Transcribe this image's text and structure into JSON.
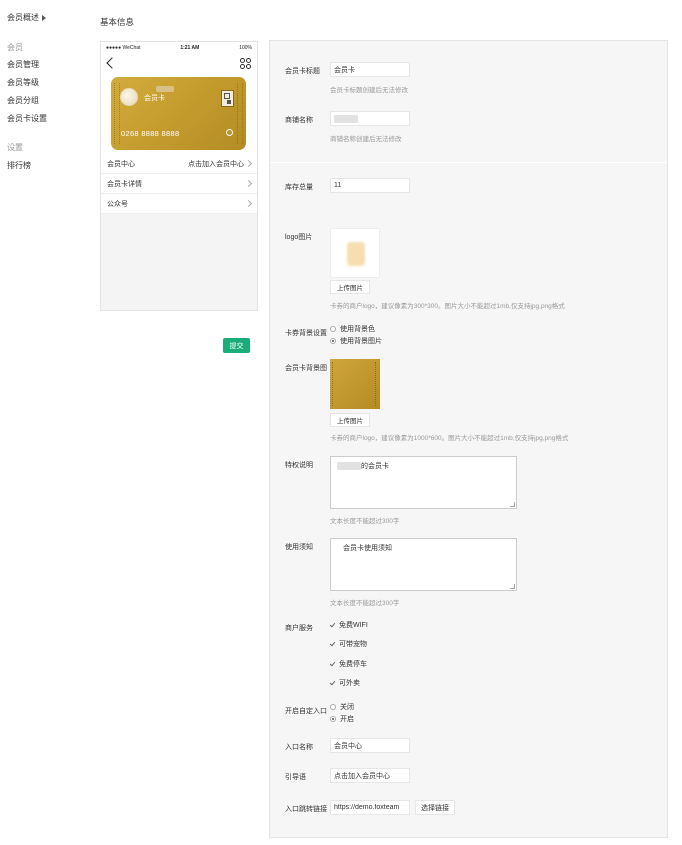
{
  "sidebar": {
    "overview": "会员概述",
    "group_member": "会员",
    "items_member": [
      "会员管理",
      "会员等级",
      "会员分组",
      "会员卡设置"
    ],
    "group_settings": "设置",
    "items_settings": [
      "排行榜"
    ]
  },
  "page_title": "基本信息",
  "phone": {
    "carrier": "●●●●● WeChat",
    "time": "1:21 AM",
    "battery": "100%",
    "card_name": "会员卡",
    "card_number": "0268 8888 8888",
    "rows": [
      {
        "label": "会员中心",
        "value": "点击加入会员中心"
      },
      {
        "label": "会员卡详情",
        "value": ""
      },
      {
        "label": "公众号",
        "value": ""
      }
    ]
  },
  "submit_label": "提交",
  "form": {
    "card_title": {
      "label": "会员卡标题",
      "value": "会员卡",
      "hint": "会员卡标题创建后无法修改"
    },
    "shop_name": {
      "label": "商铺名称",
      "value": "",
      "hint": "商铺名称创建后无法修改"
    },
    "stock": {
      "label": "库存总量",
      "value": "11"
    },
    "logo": {
      "label": "logo图片",
      "upload": "上传图片",
      "hint": "卡券的商户logo，建议像素为300*300。图片大小不能超过1mb,仅支持jpg,png格式"
    },
    "background": {
      "label": "卡券背景设置",
      "options": [
        "使用背景色",
        "使用背景图片"
      ],
      "selected": 1
    },
    "bg_image": {
      "label": "会员卡背景图",
      "upload": "上传图片",
      "hint": "卡券的商户logo，建议像素为1000*600。图片大小不能超过1mb,仅支持jpg,png格式"
    },
    "privilege": {
      "label": "特权说明",
      "value": "的会员卡",
      "hint": "文本长度不能超过300字"
    },
    "usage": {
      "label": "使用须知",
      "value": "会员卡使用须知",
      "hint": "文本长度不能超过300字"
    },
    "services": {
      "label": "商户服务",
      "options": [
        "免费WIFI",
        "可带宠物",
        "免费停车",
        "可外卖"
      ]
    },
    "custom_entry": {
      "label": "开启自定入口",
      "options": [
        "关闭",
        "开启"
      ],
      "selected": 1
    },
    "entry_name": {
      "label": "入口名称",
      "value": "会员中心"
    },
    "guide": {
      "label": "引导语",
      "value": "点击加入会员中心"
    },
    "entry_link": {
      "label": "入口跳转链接",
      "value": "https://demo.foxteam",
      "button": "选择链接"
    }
  }
}
